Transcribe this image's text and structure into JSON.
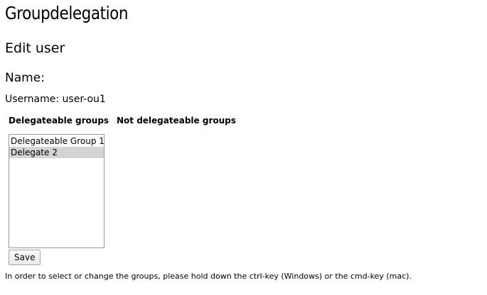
{
  "header": {
    "app_title": "Groupdelegation"
  },
  "page": {
    "heading": "Edit user"
  },
  "user": {
    "name_label": "Name:",
    "username_line": "Username: user-ou1"
  },
  "groups": {
    "delegateable_header": "Delegateable groups",
    "not_delegateable_header": "Not delegateable groups",
    "options": [
      {
        "label": "Delegateable Group 1",
        "selected": false
      },
      {
        "label": "Delegate 2",
        "selected": true
      }
    ]
  },
  "actions": {
    "save_label": "Save"
  },
  "help": {
    "text": "In order to select or change the groups, please hold down the ctrl-key (Windows) or the cmd-key (mac)."
  },
  "colors": {
    "selected_option_bg": "#d4d4d4",
    "list_border": "#9a9a9a"
  }
}
